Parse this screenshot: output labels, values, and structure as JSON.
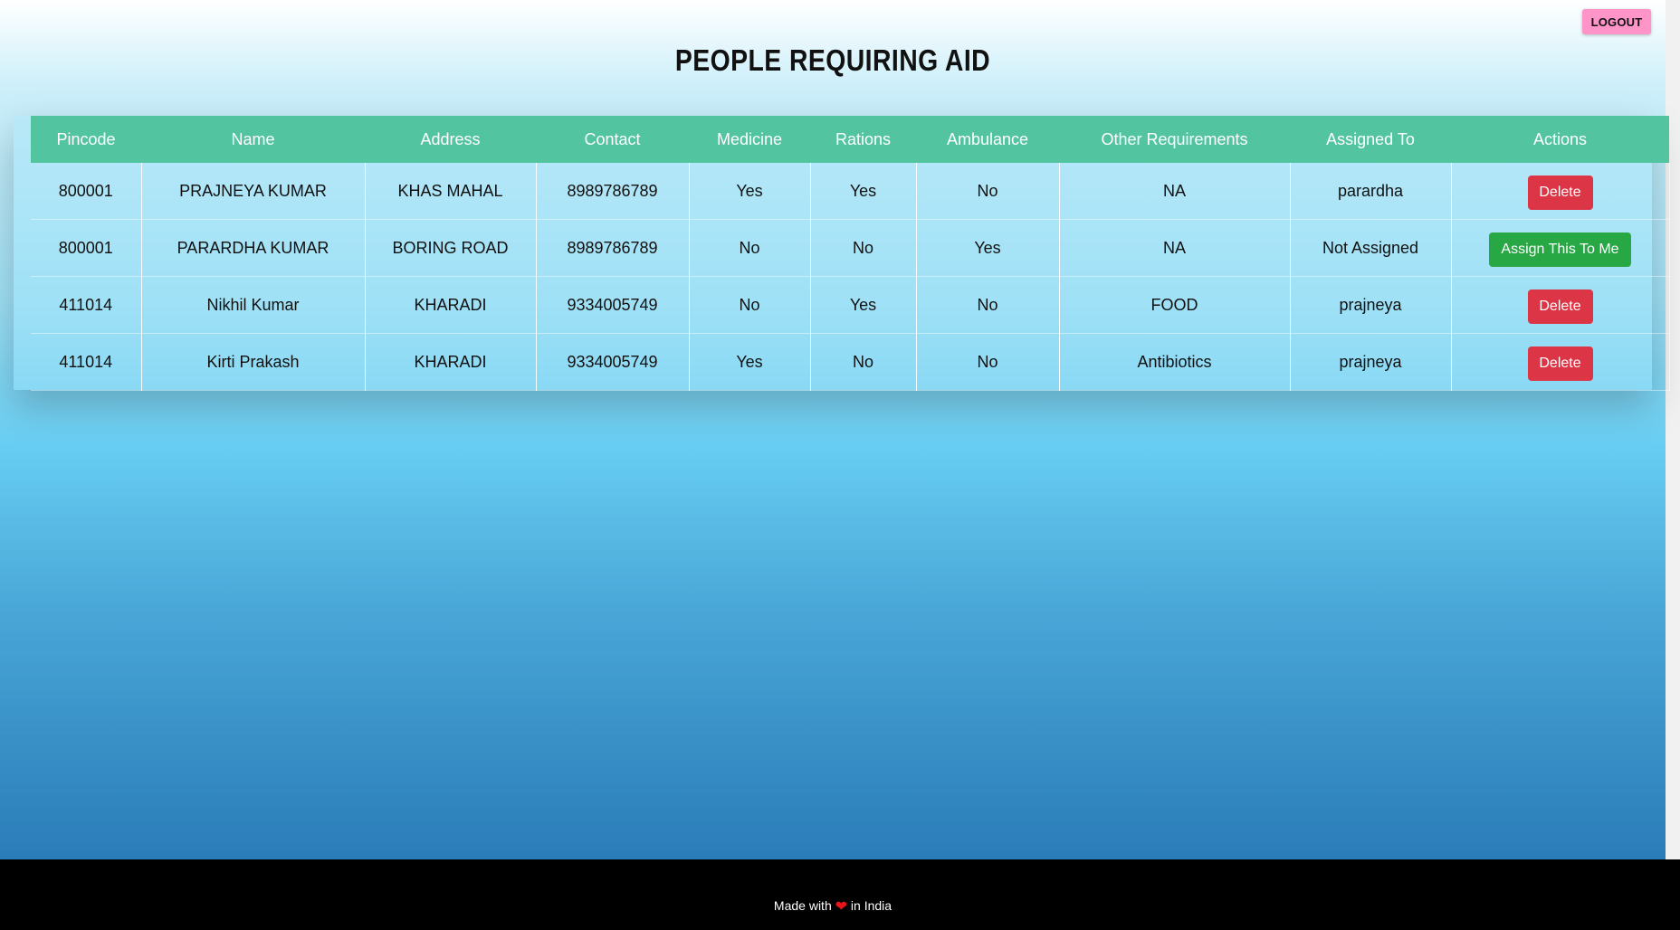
{
  "header": {
    "logout_label": "LOGOUT",
    "title": "PEOPLE REQUIRING AID"
  },
  "table": {
    "columns": [
      "Pincode",
      "Name",
      "Address",
      "Contact",
      "Medicine",
      "Rations",
      "Ambulance",
      "Other Requirements",
      "Assigned To",
      "Actions"
    ],
    "rows": [
      {
        "pincode": "800001",
        "name": "PRAJNEYA KUMAR",
        "address": "KHAS MAHAL",
        "contact": "8989786789",
        "medicine": "Yes",
        "rations": "Yes",
        "ambulance": "No",
        "other": "NA",
        "assigned_to": "parardha",
        "action": "Delete"
      },
      {
        "pincode": "800001",
        "name": "PARARDHA KUMAR",
        "address": "BORING ROAD",
        "contact": "8989786789",
        "medicine": "No",
        "rations": "No",
        "ambulance": "Yes",
        "other": "NA",
        "assigned_to": "Not Assigned",
        "action": "Assign This To Me"
      },
      {
        "pincode": "411014",
        "name": "Nikhil Kumar",
        "address": "KHARADI",
        "contact": "9334005749",
        "medicine": "No",
        "rations": "Yes",
        "ambulance": "No",
        "other": "FOOD",
        "assigned_to": "prajneya",
        "action": "Delete"
      },
      {
        "pincode": "411014",
        "name": "Kirti Prakash",
        "address": "KHARADI",
        "contact": "9334005749",
        "medicine": "Yes",
        "rations": "No",
        "ambulance": "No",
        "other": "Antibiotics",
        "assigned_to": "prajneya",
        "action": "Delete"
      }
    ]
  },
  "footer": {
    "made_with": "Made with",
    "in_india": "in India",
    "heart_icon": "heart-icon"
  },
  "colors": {
    "header_row": "#52c4a0",
    "delete_button": "#dc3545",
    "assign_button": "#28a745",
    "logout_button": "#ff94c9"
  }
}
